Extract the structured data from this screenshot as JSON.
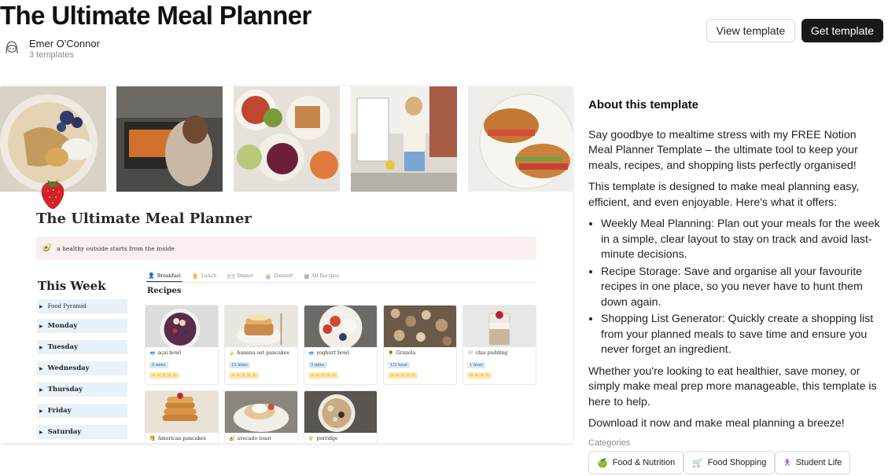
{
  "header": {
    "title": "The Ultimate Meal Planner",
    "author_name": "Emer O'Connor",
    "author_templates": "3 templates",
    "view_button": "View template",
    "get_button": "Get template"
  },
  "preview": {
    "doc_title": "The Ultimate Meal Planner",
    "callout_text": "a healthy outside starts from the inside",
    "week_title": "This Week",
    "week_items": [
      "Food Pyramid",
      "Monday",
      "Tuesday",
      "Wednesday",
      "Thursday",
      "Friday",
      "Saturday"
    ],
    "tabs": [
      "Breakfast",
      "Lunch",
      "Dinner",
      "Dessert",
      "All Recipes"
    ],
    "recipes_heading": "Recipes",
    "recipes": [
      {
        "name": "açai bowl",
        "time": "5 mins",
        "stars": "⭐⭐⭐⭐⭐"
      },
      {
        "name": "banana oat pancakes",
        "time": "15 mins",
        "stars": "⭐⭐⭐⭐⭐"
      },
      {
        "name": "yoghurt bowl",
        "time": "5 mins",
        "stars": "⭐⭐⭐⭐⭐"
      },
      {
        "name": "Granola",
        "time": "1/2 hour",
        "stars": "⭐⭐⭐⭐⭐"
      },
      {
        "name": "chia pudding",
        "time": "1 hour",
        "stars": "⭐⭐⭐⭐"
      },
      {
        "name": "American pancakes"
      },
      {
        "name": "avocado toast"
      },
      {
        "name": "porridge"
      }
    ]
  },
  "about": {
    "heading": "About this template",
    "intro": "Say goodbye to mealtime stress with my FREE Notion Meal Planner Template – the ultimate tool to keep your meals, recipes, and shopping lists perfectly organised!",
    "lead": "This template is designed to make meal planning easy, efficient, and even enjoyable. Here's what it offers:",
    "features": [
      "Weekly Meal Planning: Plan out your meals for the week in a simple, clear layout to stay on track and avoid last-minute decisions.",
      "Recipe Storage: Save and organise all your favourite recipes in one place, so you never have to hunt them down again.",
      "Shopping List Generator: Quickly create a shopping list from your planned meals to save time and ensure you never forget an ingredient."
    ],
    "closing": "Whether you're looking to eat healthier, save money, or simply make meal prep more manageable, this template is here to help.",
    "cta": "Download it now and make meal planning a breeze!"
  },
  "categories": {
    "label": "Categories",
    "items": [
      {
        "label": "Food & Nutrition",
        "icon": "apple-icon"
      },
      {
        "label": "Food Shopping",
        "icon": "shopping-cart-icon"
      },
      {
        "label": "Student Life",
        "icon": "person-icon"
      }
    ]
  }
}
